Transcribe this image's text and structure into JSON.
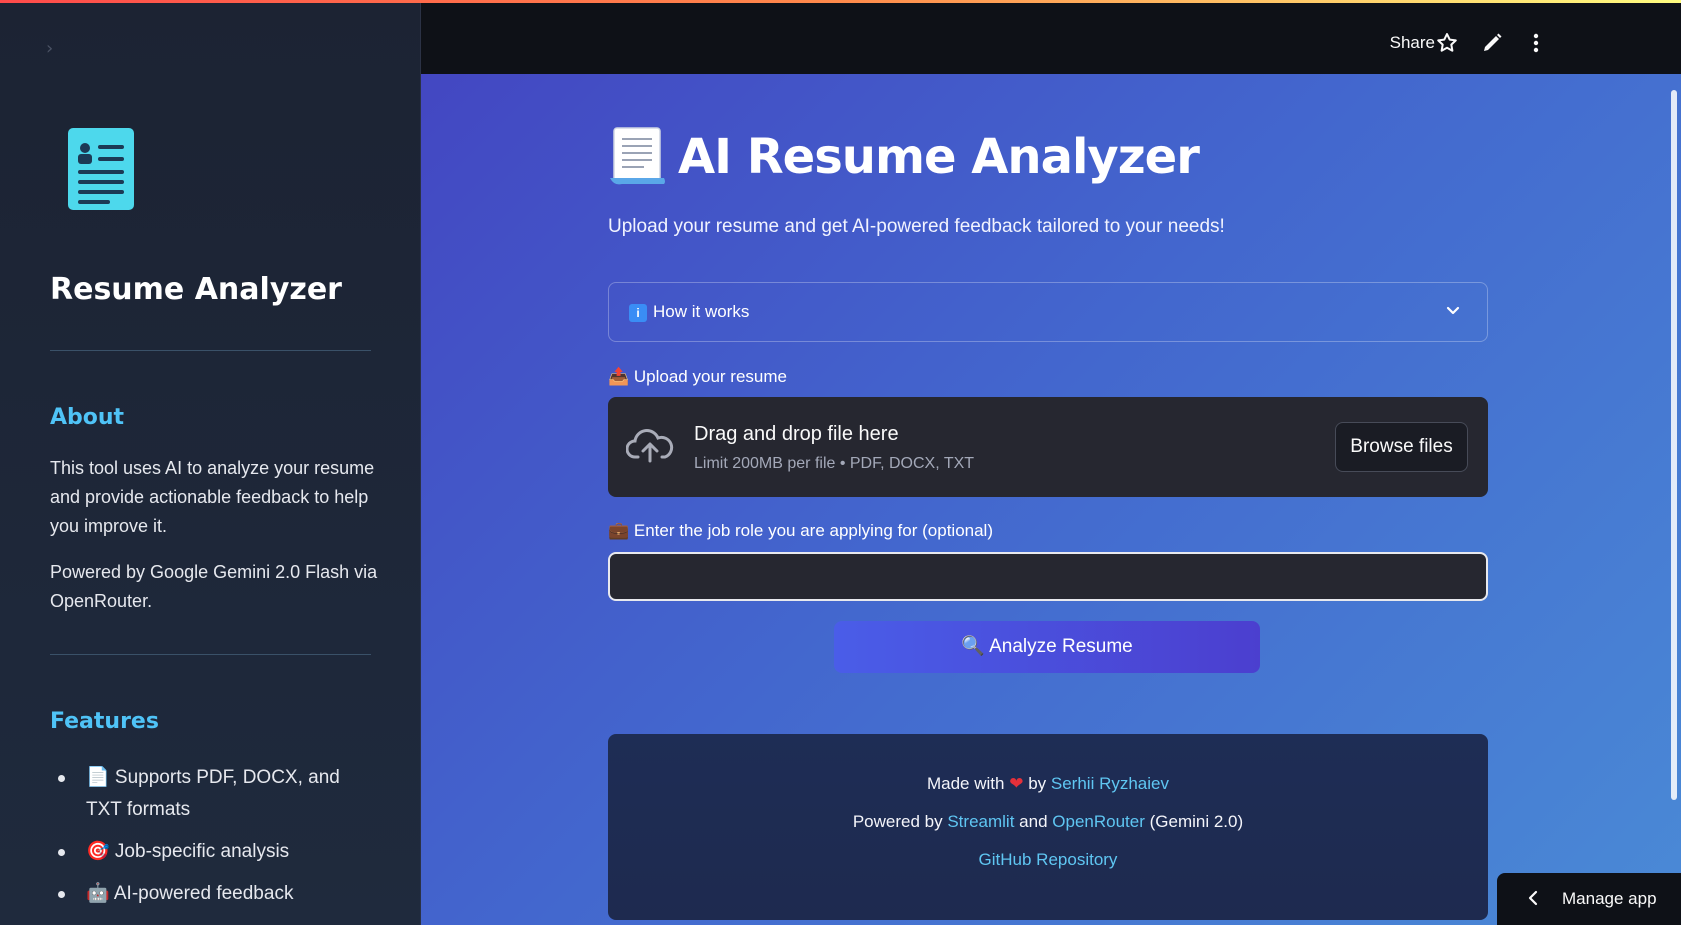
{
  "header": {
    "share_label": "Share",
    "icons": [
      "star-icon",
      "pencil-icon",
      "more-vertical-icon"
    ]
  },
  "sidebar": {
    "collapse_icon": "chevron-right-icon",
    "logo_icon": "resume-document-icon",
    "title": "Resume Analyzer",
    "about_heading": "About",
    "about_text": "This tool uses AI to analyze your resume and provide actionable feedback to help you improve it.",
    "powered_text": "Powered by Google Gemini 2.0 Flash via OpenRouter.",
    "features_heading": "Features",
    "features": [
      "📄 Supports PDF, DOCX, and TXT formats",
      "🎯 Job-specific analysis",
      "🤖 AI-powered feedback"
    ]
  },
  "main": {
    "title": "AI Resume Analyzer",
    "subtitle": "Upload your resume and get AI-powered feedback tailored to your needs!",
    "expander_label": "How it works",
    "upload_label": "📤 Upload your resume",
    "uploader": {
      "title": "Drag and drop file here",
      "limit": "Limit 200MB per file • PDF, DOCX, TXT",
      "browse_label": "Browse files"
    },
    "job_label": "💼 Enter the job role you are applying for (optional)",
    "job_value": "",
    "analyze_label": "🔍 Analyze Resume",
    "footer": {
      "made_with": "Made with",
      "by": "by",
      "author": "Serhii Ryzhaiev",
      "powered_by": "Powered by",
      "streamlit": "Streamlit",
      "and": "and",
      "openrouter": "OpenRouter",
      "model": "(Gemini 2.0)",
      "github": "GitHub Repository"
    }
  },
  "manage_app": {
    "label": "Manage app"
  },
  "colors": {
    "accent_cyan": "#4fc3f7",
    "link": "#5fc6f2",
    "main_gradient_start": "#4347c2",
    "main_gradient_end": "#4a8ad6",
    "button": "#4a5de8"
  }
}
